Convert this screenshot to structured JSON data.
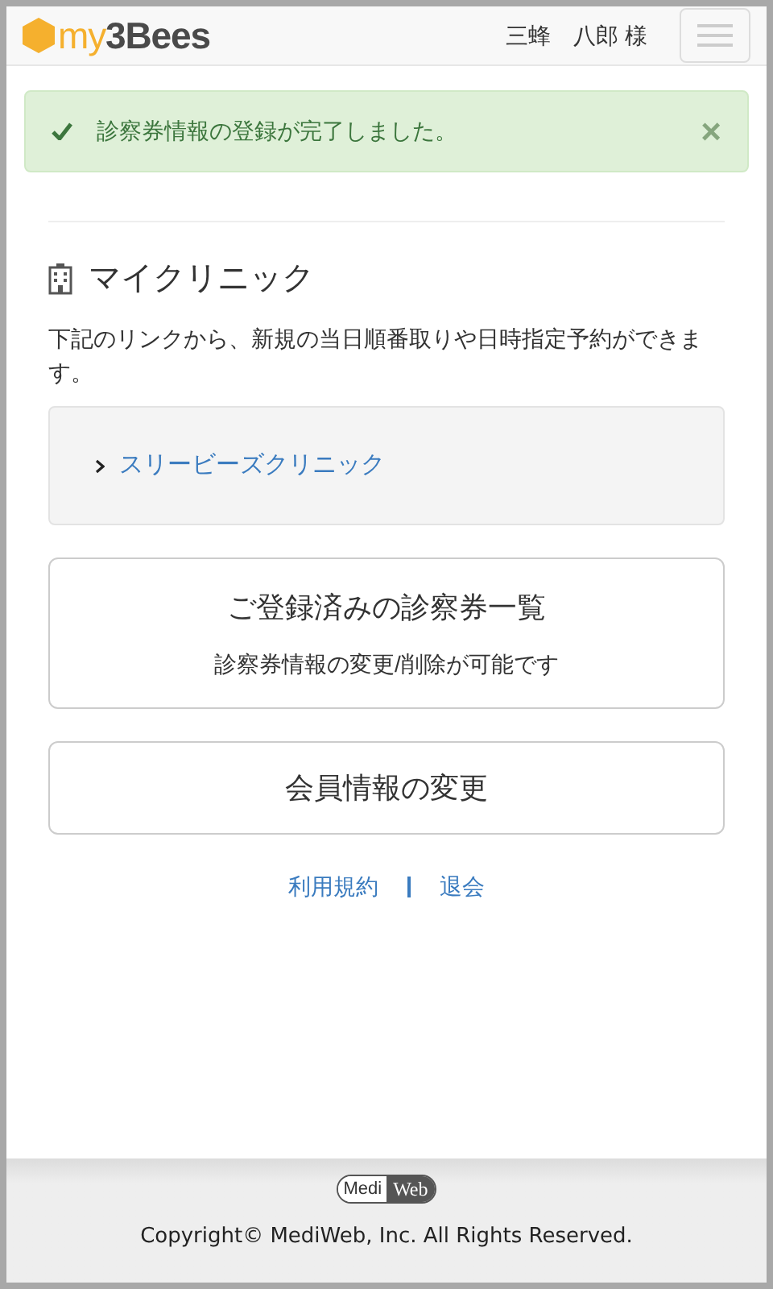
{
  "header": {
    "logo": {
      "prefix": "my",
      "name": "3Bees"
    },
    "user": "三蜂　八郎 様"
  },
  "alert": {
    "message": "診察券情報の登録が完了しました。",
    "close": "×"
  },
  "clinic_section": {
    "title": "マイクリニック",
    "description": "下記のリンクから、新規の当日順番取りや日時指定予約ができます。",
    "clinics": [
      {
        "name": "スリービーズクリニック"
      }
    ]
  },
  "cards": [
    {
      "title": "ご登録済みの診察券一覧",
      "subtitle": "診察券情報の変更/削除が可能です"
    },
    {
      "title": "会員情報の変更"
    }
  ],
  "links": [
    "利用規約",
    "退会"
  ],
  "footer": {
    "logo": {
      "left": "Medi",
      "right": "Web"
    },
    "copyright": "Copyright© MediWeb, Inc. All Rights Reserved."
  }
}
